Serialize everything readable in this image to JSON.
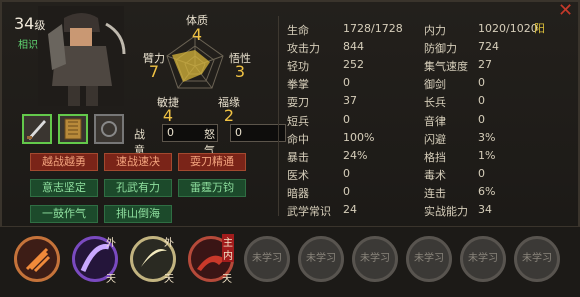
{
  "header": {
    "level": "34",
    "level_unit": "级",
    "relation": "相识"
  },
  "radar": {
    "tizhi": {
      "label": "体质",
      "value": "4"
    },
    "wuxing": {
      "label": "悟性",
      "value": "3"
    },
    "fuyuan": {
      "label": "福缘",
      "value": "2"
    },
    "minjie": {
      "label": "敏捷",
      "value": "4"
    },
    "bili": {
      "label": "臂力",
      "value": "7"
    }
  },
  "boxes": {
    "zhanyi_label": "战意",
    "zhanyi_value": "0",
    "nuqi_label": "怒气",
    "nuqi_value": "0"
  },
  "traits": [
    {
      "label": "越战越勇",
      "style": "red"
    },
    {
      "label": "速战速决",
      "style": "red"
    },
    {
      "label": "耍刀精通",
      "style": "red"
    },
    {
      "label": "意志坚定",
      "style": "green"
    },
    {
      "label": "孔武有力",
      "style": "green"
    },
    {
      "label": "雷霆万钧",
      "style": "green"
    },
    {
      "label": "一鼓作气",
      "style": "green"
    },
    {
      "label": "排山倒海",
      "style": "green"
    }
  ],
  "stats_left": [
    {
      "k": "生命",
      "v": "1728/1728"
    },
    {
      "k": "攻击力",
      "v": "844"
    },
    {
      "k": "轻功",
      "v": "252"
    },
    {
      "k": "拳掌",
      "v": "0"
    },
    {
      "k": "耍刀",
      "v": "37"
    },
    {
      "k": "短兵",
      "v": "0"
    },
    {
      "k": "命中",
      "v": "100%"
    },
    {
      "k": "暴击",
      "v": "24%"
    },
    {
      "k": "医术",
      "v": "0"
    },
    {
      "k": "暗器",
      "v": "0"
    },
    {
      "k": "武学常识",
      "v": "24"
    }
  ],
  "stats_right": [
    {
      "k": "内力",
      "v": "1020/1020"
    },
    {
      "k": "防御力",
      "v": "724"
    },
    {
      "k": "集气速度",
      "v": "27"
    },
    {
      "k": "御剑",
      "v": "0"
    },
    {
      "k": "长兵",
      "v": "0"
    },
    {
      "k": "音律",
      "v": "0"
    },
    {
      "k": "闪避",
      "v": "3%"
    },
    {
      "k": "格挡",
      "v": "1%"
    },
    {
      "k": "毒术",
      "v": "0"
    },
    {
      "k": "连击",
      "v": "6%"
    },
    {
      "k": "实战能力",
      "v": "34"
    }
  ],
  "yang": "阳",
  "skills": {
    "wai": "外",
    "tian": "天",
    "zhu": "主",
    "nei": "内",
    "locked_label": "未学习"
  },
  "colors": {
    "red_btn": "#7a2418",
    "green_btn": "#1c4a2b",
    "gold": "#f0c244",
    "level_green": "#5fd470"
  }
}
